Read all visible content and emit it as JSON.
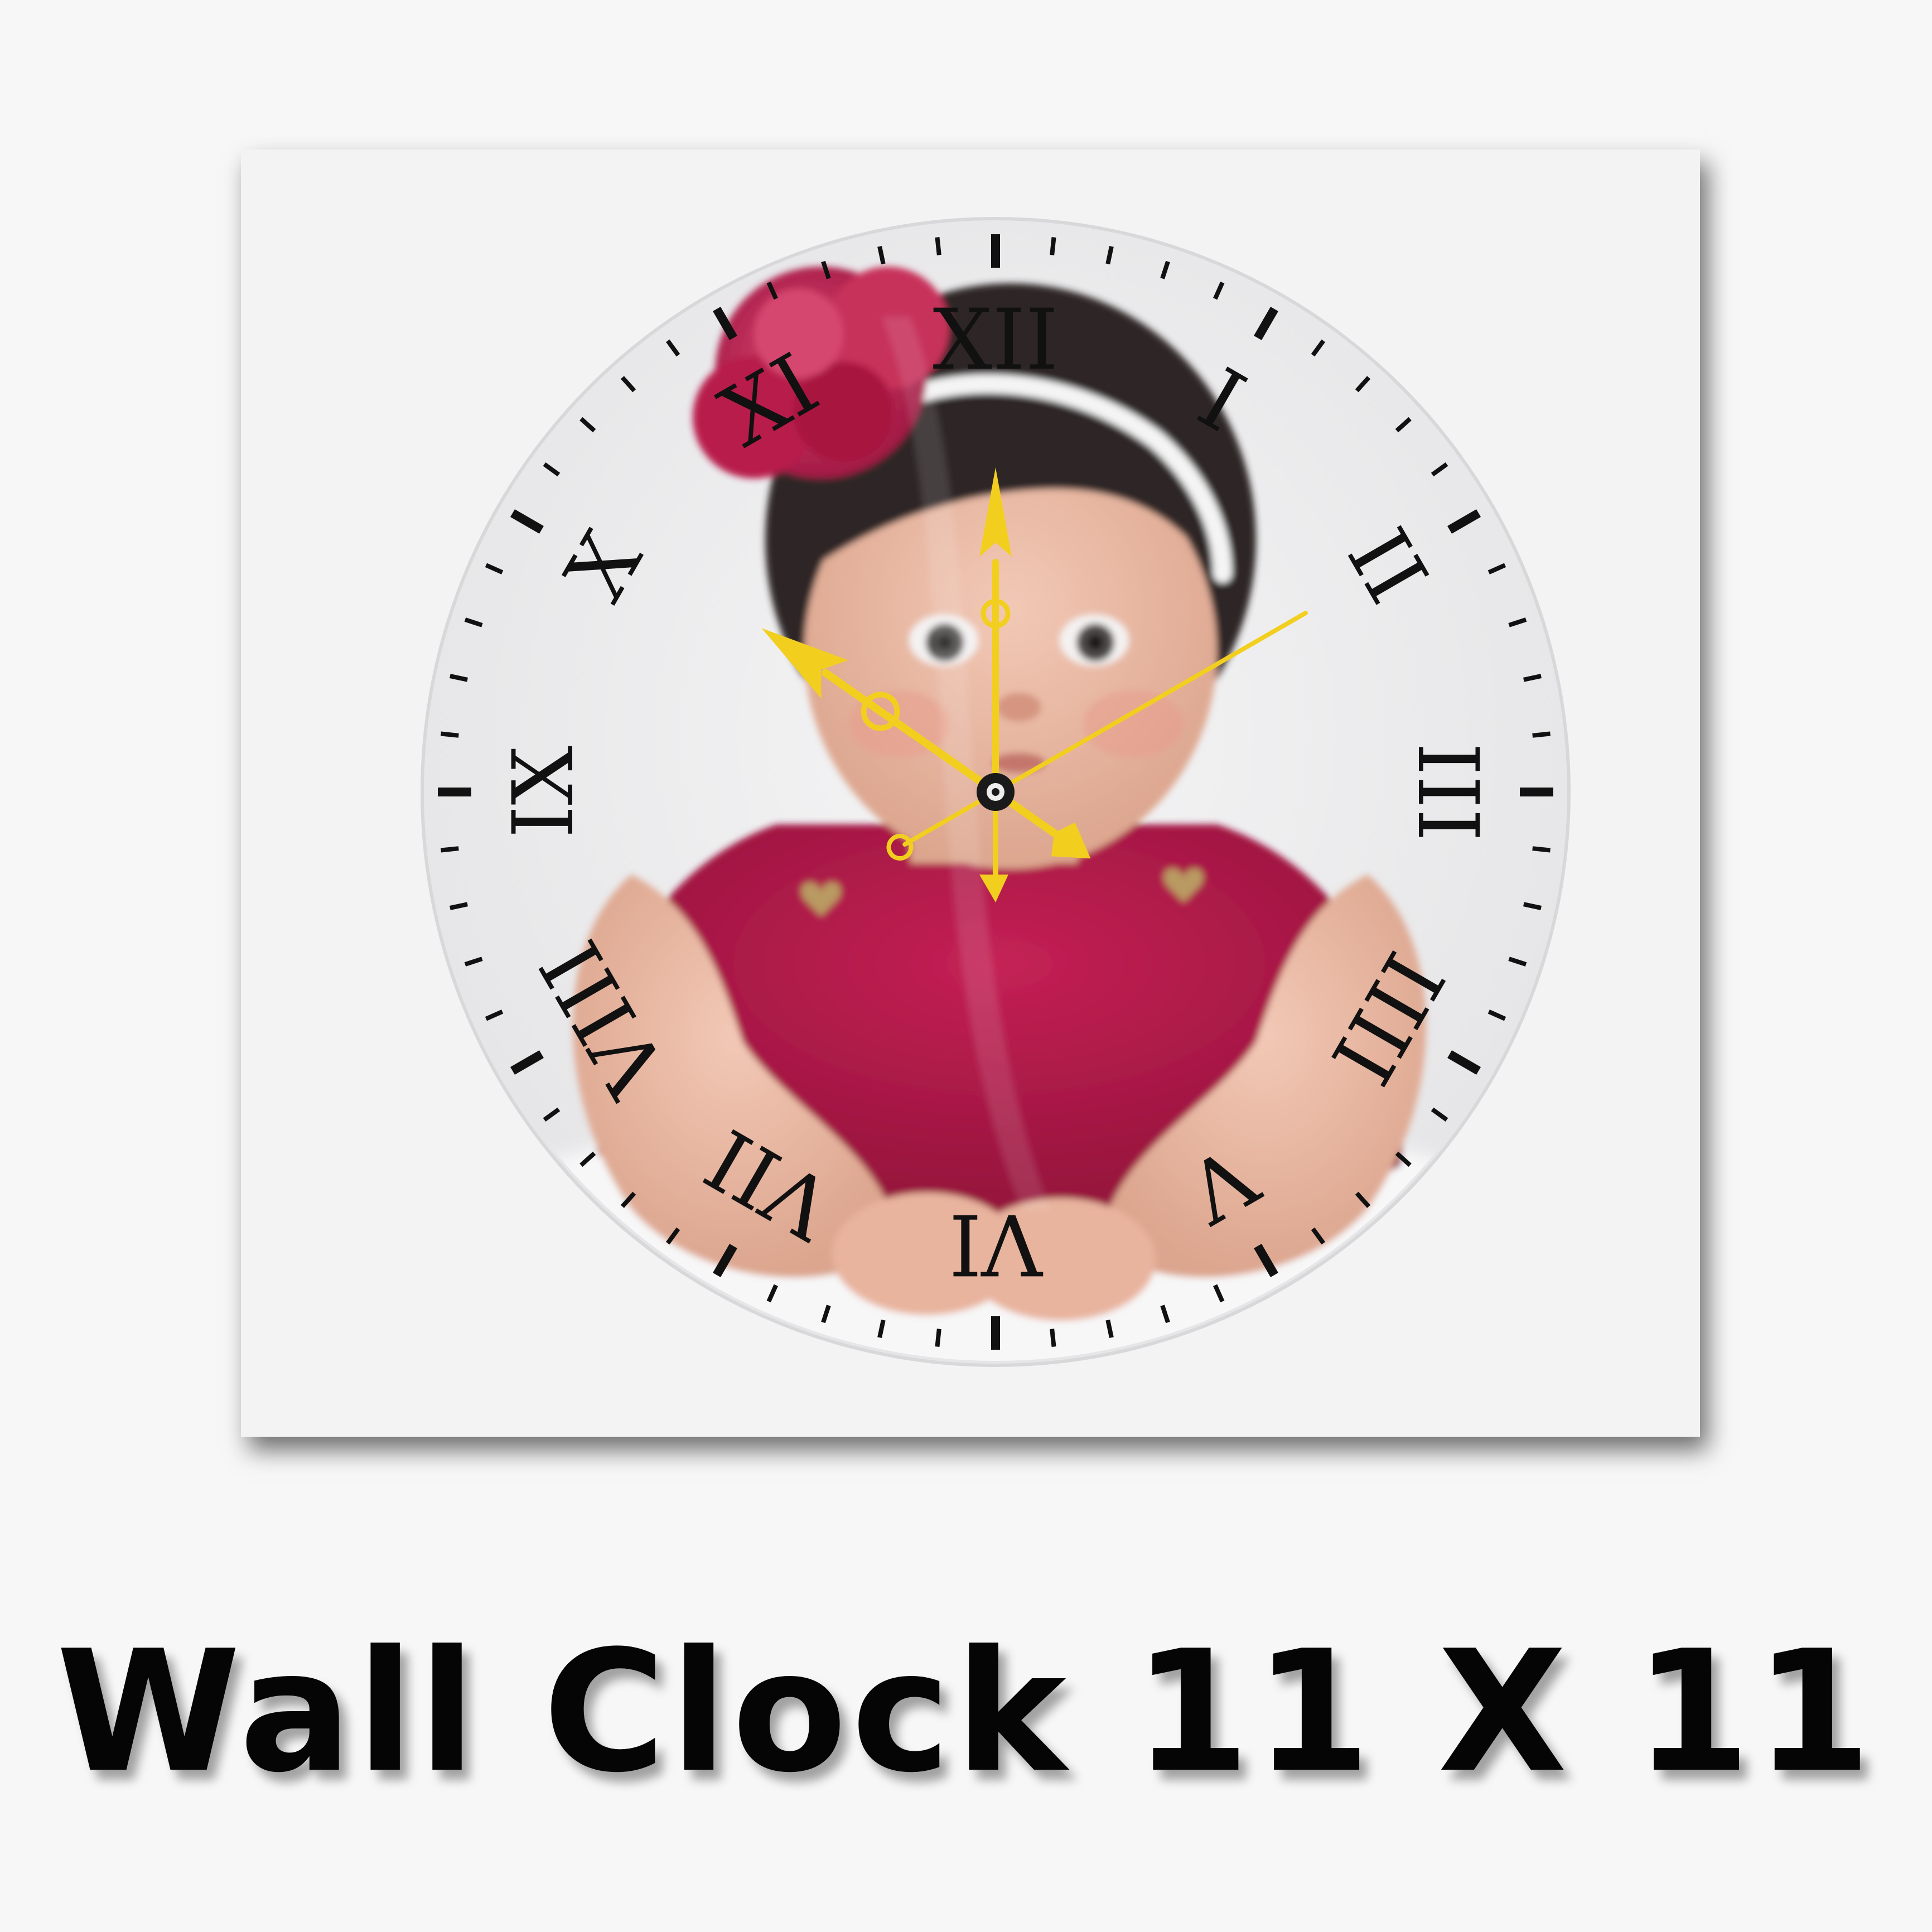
{
  "product": {
    "caption": "Wall Clock 11 X 11"
  },
  "clock": {
    "numerals": [
      "XII",
      "I",
      "II",
      "III",
      "IIII",
      "V",
      "VI",
      "VII",
      "VIII",
      "IX",
      "X",
      "XI"
    ],
    "time_shown": "10:09",
    "hand_color": "#f2cf1e",
    "numeral_color": "#111111",
    "face_color": "#f1f1f2"
  },
  "photo": {
    "dress_color": "#b2194a",
    "flower_color": "#c0234f",
    "hair_color": "#2e2626",
    "skin_color": "#e9b9a4",
    "background_color": "#ececee"
  }
}
